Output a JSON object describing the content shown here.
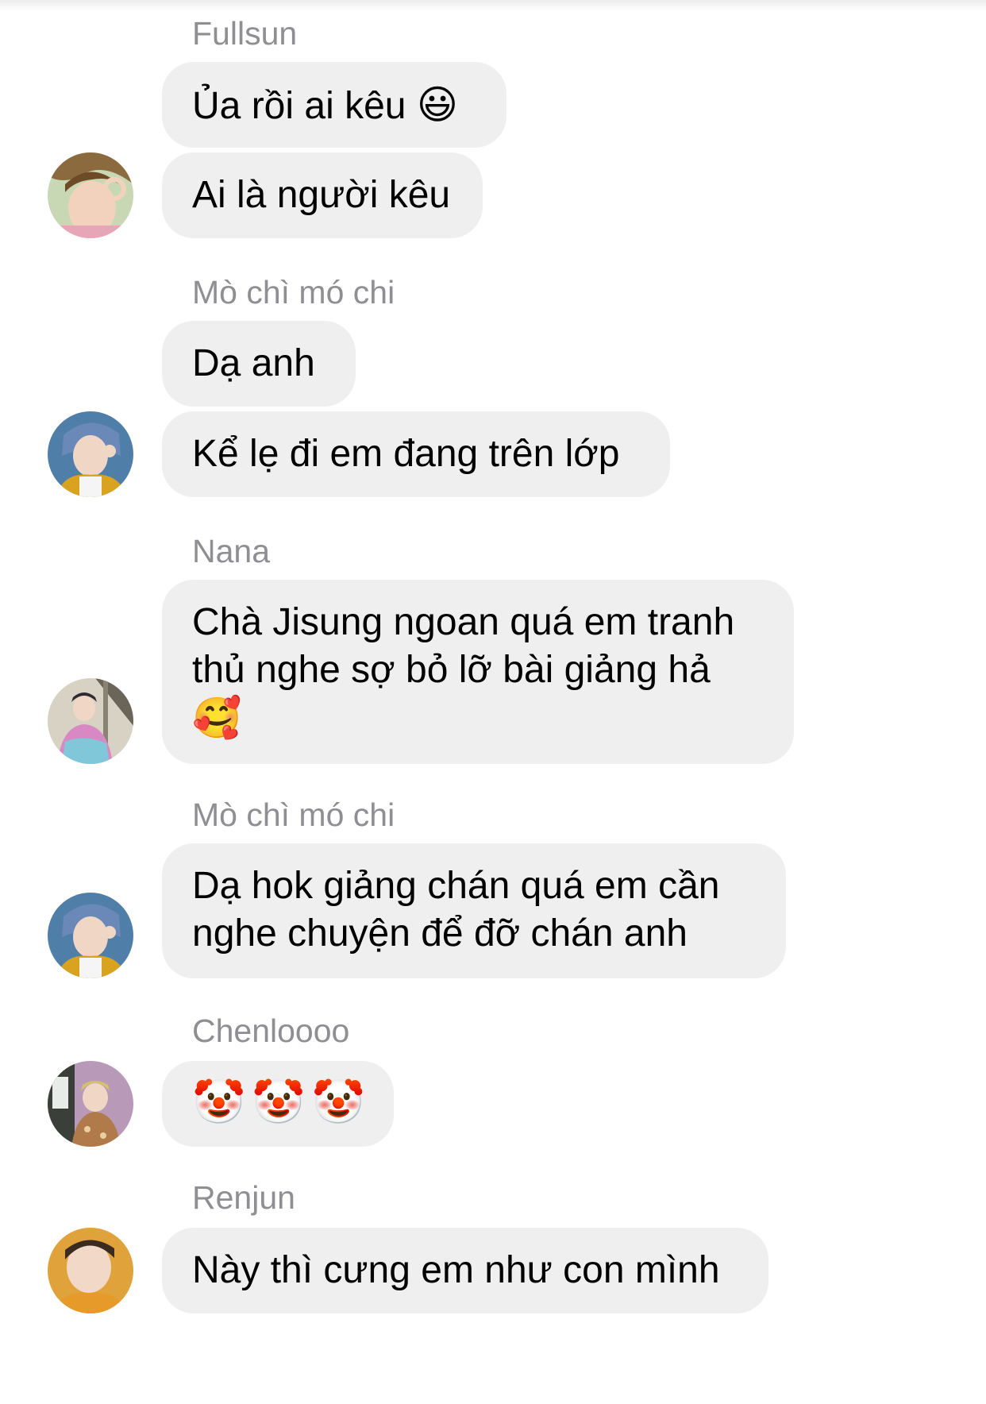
{
  "conversation": {
    "groups": [
      {
        "sender": "Fullsun",
        "messages": [
          "Ủa rồi ai kêu",
          "Ai là người kêu"
        ],
        "emoji": "😃",
        "avatar_icon": "avatar-photo-icon"
      },
      {
        "sender": "Mò chì mó chi",
        "messages": [
          "Dạ anh",
          "Kể lẹ đi em đang trên lớp"
        ],
        "avatar_icon": "avatar-photo-icon"
      },
      {
        "sender": "Nana",
        "messages": [
          "Chà Jisung ngoan quá em tranh thủ nghe sợ bỏ lỡ bài giảng hả"
        ],
        "emoji": "🥰",
        "avatar_icon": "avatar-photo-icon"
      },
      {
        "sender": "Mò chì mó chi",
        "messages": [
          "Dạ hok giảng chán quá em cần nghe chuyện để đỡ chán anh"
        ],
        "avatar_icon": "avatar-photo-icon"
      },
      {
        "sender": "Chenloooo",
        "messages": [
          "🤡🤡🤡"
        ],
        "avatar_icon": "avatar-photo-icon"
      },
      {
        "sender": "Renjun",
        "messages": [
          "Này thì cưng em như con mình"
        ],
        "avatar_icon": "avatar-photo-icon"
      }
    ]
  },
  "colors": {
    "bubble": "#efefef",
    "sender_name": "#8e8e93",
    "text": "#000000",
    "background": "#ffffff"
  }
}
